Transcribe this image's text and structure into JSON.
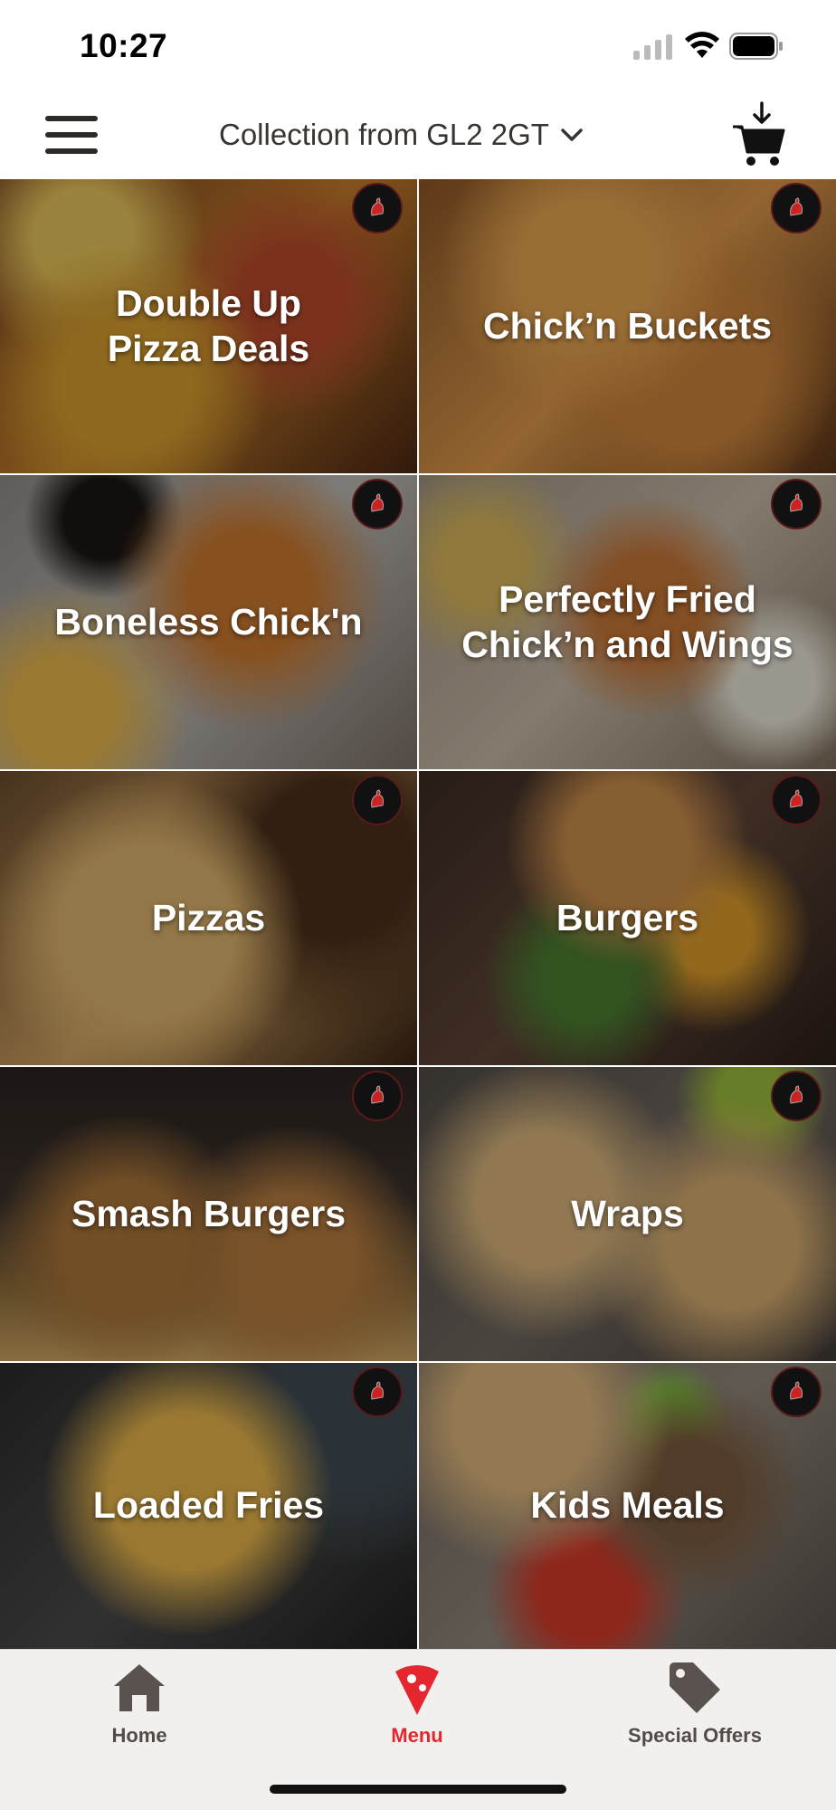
{
  "status_bar": {
    "time": "10:27",
    "icons": [
      "cellular-signal-icon",
      "wifi-icon",
      "battery-icon"
    ]
  },
  "header": {
    "menu_icon": "hamburger-menu-icon",
    "collection_label": "Collection from GL2 2GT",
    "chevron_icon": "chevron-down-icon",
    "cart_icon": "cart-icon"
  },
  "categories": [
    {
      "label": "Double Up\nPizza Deals",
      "name": "category-double-up-pizza-deals"
    },
    {
      "label": "Chick’n Buckets",
      "name": "category-chickn-buckets"
    },
    {
      "label": "Boneless Chick'n",
      "name": "category-boneless-chickn"
    },
    {
      "label": "Perfectly Fried\nChick’n and Wings",
      "name": "category-perfectly-fried"
    },
    {
      "label": "Pizzas",
      "name": "category-pizzas"
    },
    {
      "label": "Burgers",
      "name": "category-burgers"
    },
    {
      "label": "Smash Burgers",
      "name": "category-smash-burgers"
    },
    {
      "label": "Wraps",
      "name": "category-wraps"
    },
    {
      "label": "Loaded Fries",
      "name": "category-loaded-fries"
    },
    {
      "label": "Kids Meals",
      "name": "category-kids-meals"
    }
  ],
  "bottom_nav": {
    "items": [
      {
        "label": "Home",
        "icon": "home-icon",
        "active": false
      },
      {
        "label": "Menu",
        "icon": "pizza-slice-icon",
        "active": true
      },
      {
        "label": "Special Offers",
        "icon": "tag-icon",
        "active": false
      }
    ]
  },
  "colors": {
    "accent": "#e5262e",
    "nav_background": "#f2f0ef",
    "text_dark": "#3a3431"
  }
}
